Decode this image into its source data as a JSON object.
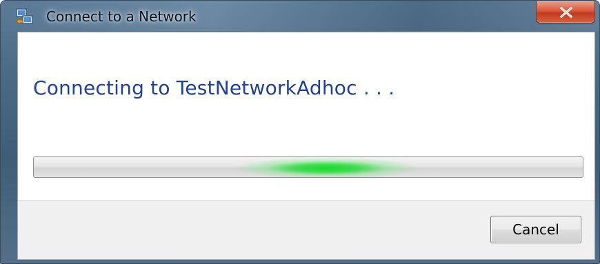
{
  "window": {
    "title": "Connect to a Network",
    "title_icon": "network-connection-icon",
    "close_icon": "close-icon"
  },
  "main": {
    "heading": "Connecting to TestNetworkAdhoc . . .",
    "progress": {
      "style": "marquee",
      "color": "#1fd23a"
    }
  },
  "footer": {
    "cancel_label": "Cancel"
  },
  "colors": {
    "heading": "#1e3f9a",
    "close_button": "#c94a2c"
  }
}
